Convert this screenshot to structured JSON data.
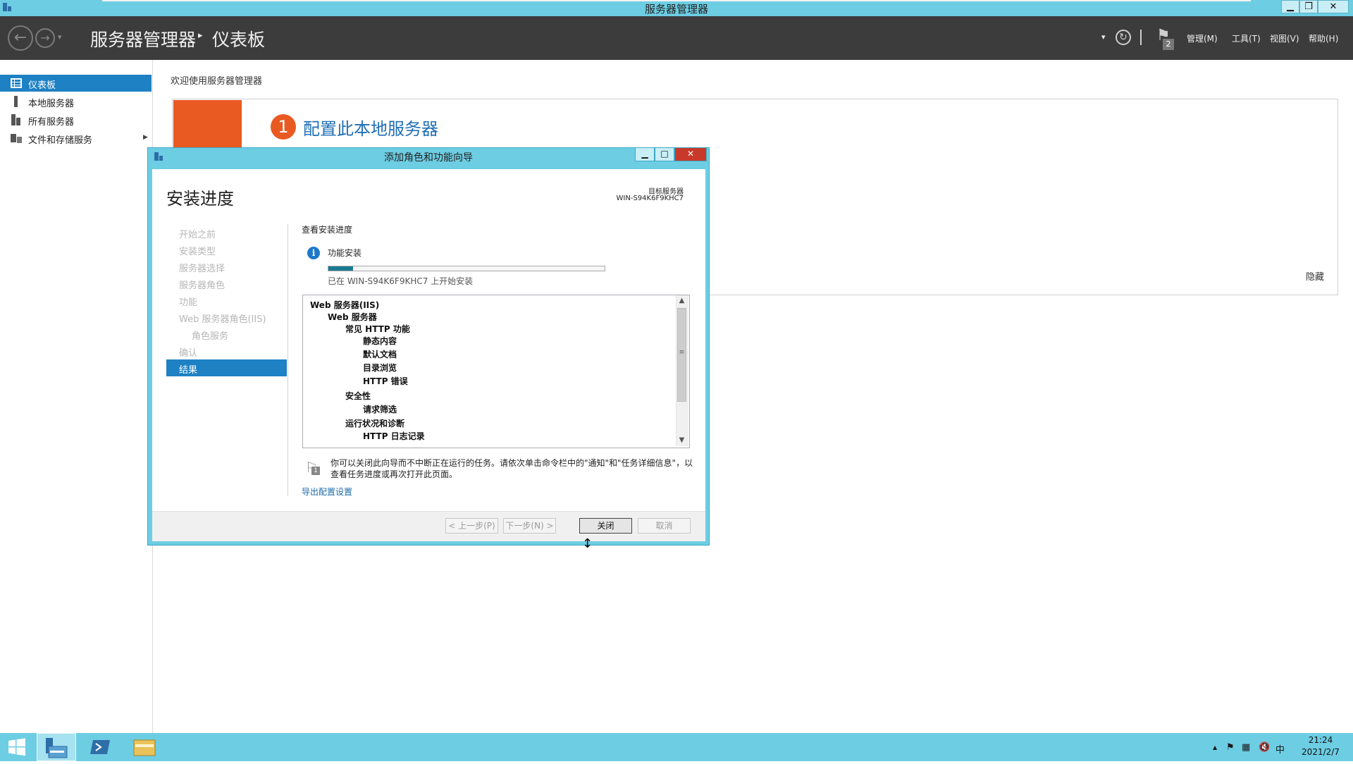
{
  "window": {
    "title": "服务器管理器",
    "minimize": "▁",
    "maximize": "❐",
    "close": "✕"
  },
  "header": {
    "breadcrumb_root": "服务器管理器",
    "breadcrumb_sep": "▸",
    "breadcrumb_page": "仪表板",
    "dropdown_arrow": "▾",
    "notifications_count": "2",
    "menus": [
      "管理(M)",
      "工具(T)",
      "视图(V)",
      "帮助(H)"
    ]
  },
  "sidebar": {
    "items": [
      {
        "label": "仪表板",
        "icon": "dashboard-icon",
        "active": true
      },
      {
        "label": "本地服务器",
        "icon": "server-icon",
        "active": false
      },
      {
        "label": "所有服务器",
        "icon": "servers-icon",
        "active": false
      },
      {
        "label": "文件和存储服务",
        "icon": "storage-icon",
        "active": false,
        "expandable": true
      }
    ],
    "expand_arrow": "▶"
  },
  "main": {
    "welcome": "欢迎使用服务器管理器",
    "step_number": "1",
    "step_text": "配置此本地服务器",
    "hide": "隐藏"
  },
  "dialog": {
    "title": "添加角色和功能向导",
    "heading": "安装进度",
    "target_label": "目标服务器",
    "target_server": "WIN-S94K6F9KHC7",
    "steps": [
      "开始之前",
      "安装类型",
      "服务器选择",
      "服务器角色",
      "功能",
      "Web 服务器角色(IIS)",
      "角色服务",
      "确认"
    ],
    "active_step": "结果",
    "view_progress": "查看安装进度",
    "feature_install": "功能安装",
    "progress_fraction": 0.09,
    "progress_status": "已在 WIN-S94K6F9KHC7 上开始安装",
    "list_items": [
      {
        "text": "Web 服务器(IIS)",
        "level": 0
      },
      {
        "text": "Web 服务器",
        "level": 1
      },
      {
        "text": "常见 HTTP 功能",
        "level": 2
      },
      {
        "text": "静态内容",
        "level": 3
      },
      {
        "text": "默认文档",
        "level": 3
      },
      {
        "text": "目录浏览",
        "level": 3
      },
      {
        "text": "HTTP 错误",
        "level": 3
      },
      {
        "text": "安全性",
        "level": 2
      },
      {
        "text": "请求筛选",
        "level": 3
      },
      {
        "text": "运行状况和诊断",
        "level": 2
      },
      {
        "text": "HTTP 日志记录",
        "level": 3
      }
    ],
    "note_line1": "你可以关闭此向导而不中断正在运行的任务。请依次单击命令栏中的\"通知\"和\"任务详细信息\"，以",
    "note_line2": "查看任务进度或再次打开此页面。",
    "note_badge": "1",
    "export_link": "导出配置设置",
    "buttons": {
      "prev": "< 上一步(P)",
      "next": "下一步(N) >",
      "close": "关闭",
      "cancel": "取消"
    }
  },
  "taskbar": {
    "time": "21:24",
    "date": "2021/2/7",
    "ime": "中",
    "tray_up": "▲"
  },
  "colors": {
    "accent": "#1e81c4",
    "orange": "#e85a22",
    "titlebar": "#6dcde3",
    "header": "#3c3c3c"
  }
}
